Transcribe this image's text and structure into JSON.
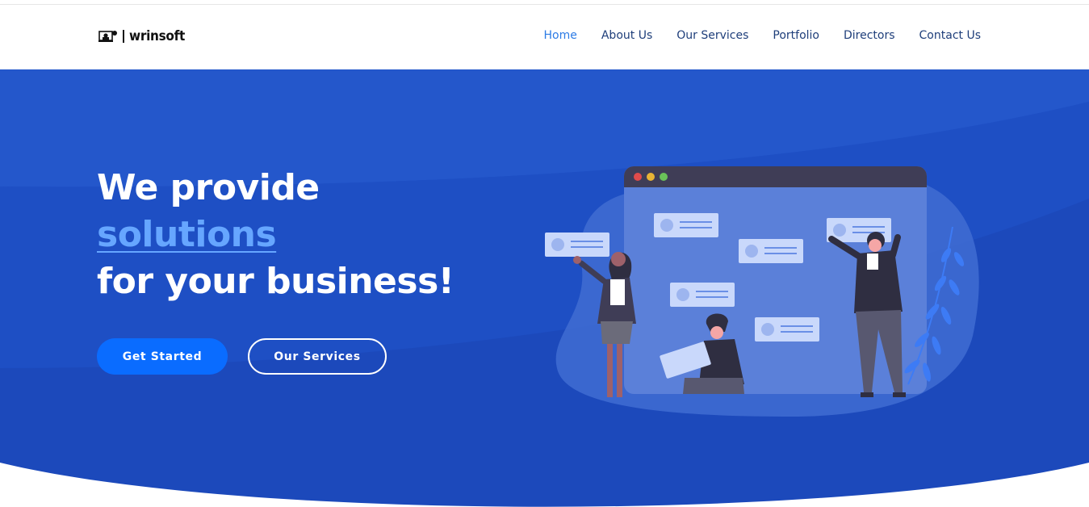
{
  "header": {
    "logo_text": "wrinsoft",
    "nav": [
      {
        "label": "Home",
        "active": true
      },
      {
        "label": "About Us",
        "active": false
      },
      {
        "label": "Our Services",
        "active": false
      },
      {
        "label": "Portfolio",
        "active": false
      },
      {
        "label": "Directors",
        "active": false
      },
      {
        "label": "Contact Us",
        "active": false
      }
    ]
  },
  "hero": {
    "line1": "We provide",
    "highlight": "solutions",
    "line3": "for your business!",
    "primary_button": "Get Started",
    "secondary_button": "Our Services"
  },
  "colors": {
    "hero_bg": "#1e4fc6",
    "accent": "#0a6cff",
    "highlight_text": "#66a6ff",
    "nav_active": "#2c7be5",
    "nav_text": "#1e3e7a"
  }
}
